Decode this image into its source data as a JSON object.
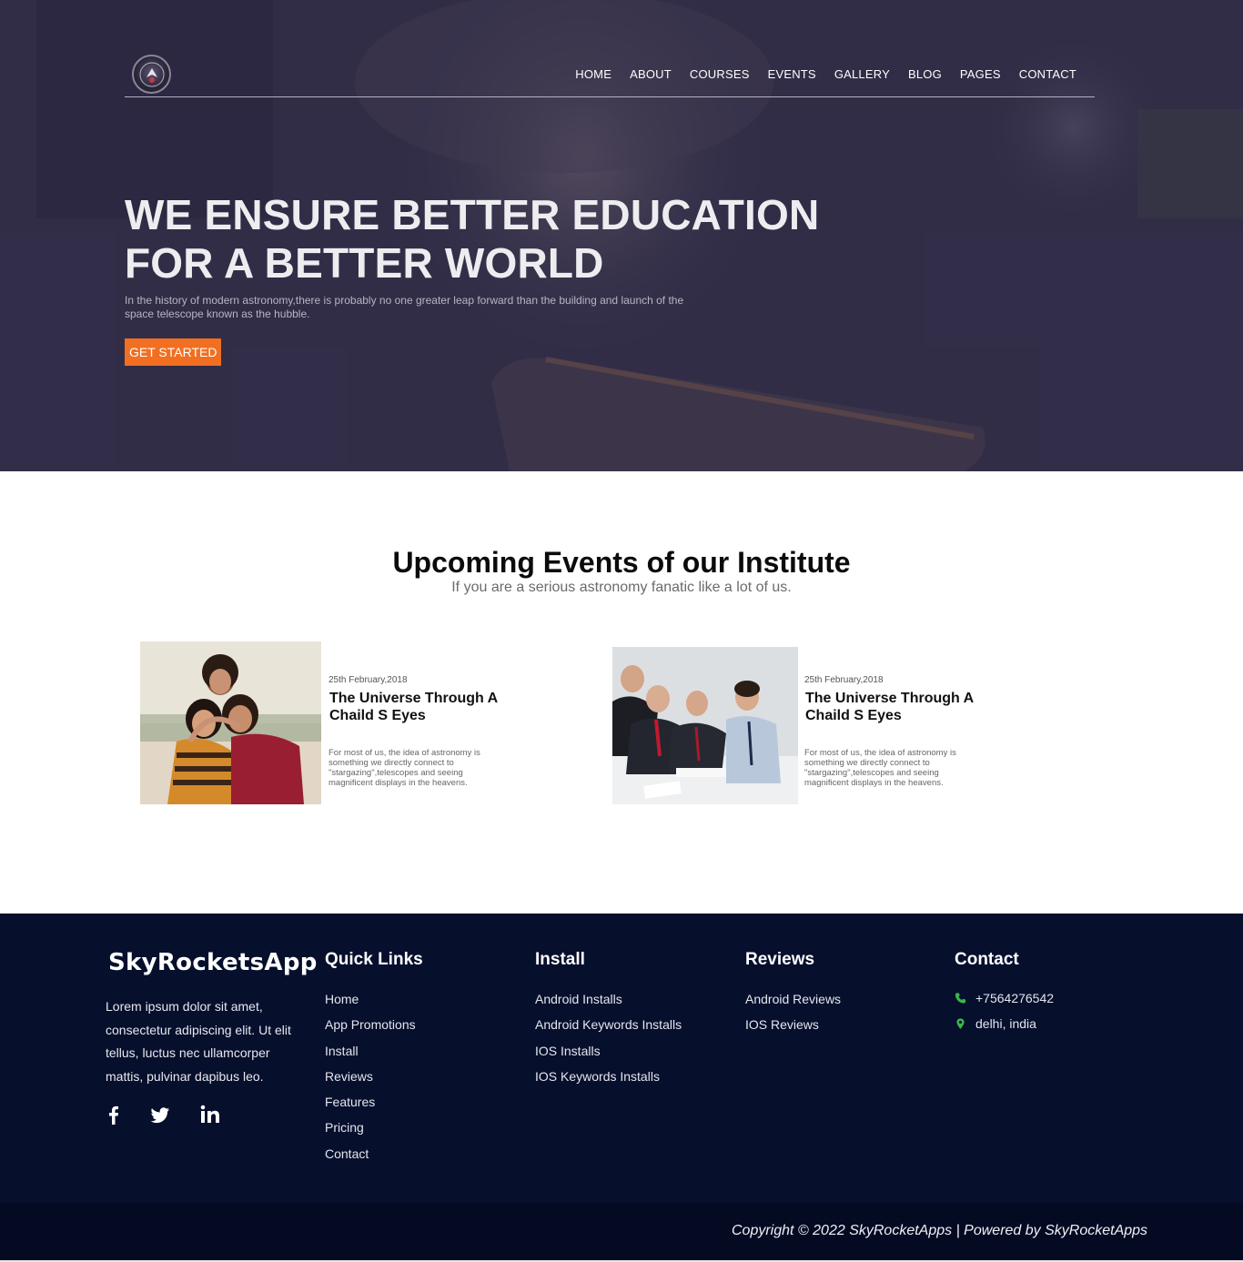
{
  "nav": {
    "items": [
      "HOME",
      "ABOUT",
      "COURSES",
      "EVENTS",
      "GALLERY",
      "BLOG",
      "PAGES",
      "CONTACT"
    ]
  },
  "hero": {
    "title_line1": "WE ENSURE BETTER EDUCATION",
    "title_line2": "FOR A BETTER WORLD",
    "subtitle": "In the history of modern astronomy,there is probably no one greater leap forward than the building and launch of the space telescope known as the hubble.",
    "cta": "GET STARTED"
  },
  "events": {
    "title": "Upcoming Events of our Institute",
    "subtitle": "If you are a serious astronomy fanatic like a lot of us.",
    "cards": [
      {
        "date": "25th February,2018",
        "title": "The Universe Through A Chaild S Eyes",
        "desc": "For most of us, the idea of astronomy is something we directly connect to \"stargazing\",telescopes and seeing magnificent displays in the heavens."
      },
      {
        "date": "25th February,2018",
        "title": "The Universe Through A Chaild S Eyes",
        "desc": "For most of us, the idea of astronomy is something we directly connect to \"stargazing\",telescopes and seeing magnificent displays in the heavens."
      }
    ]
  },
  "footer": {
    "brand": "SkyRocketsApp",
    "about": "Lorem ipsum dolor sit amet, consectetur adipiscing elit. Ut elit tellus, luctus nec ullamcorper mattis, pulvinar dapibus leo.",
    "social_icons": [
      "facebook-icon",
      "twitter-icon",
      "linkedin-icon"
    ],
    "quick_links": {
      "heading": "Quick Links",
      "items": [
        "Home",
        "App Promotions",
        "Install",
        "Reviews",
        "Features",
        "Pricing",
        "Contact"
      ]
    },
    "install": {
      "heading": "Install",
      "items": [
        "Android Installs",
        "Android Keywords Installs",
        "IOS Installs",
        "IOS Keywords Installs"
      ]
    },
    "reviews": {
      "heading": "Reviews",
      "items": [
        "Android Reviews",
        "IOS Reviews"
      ]
    },
    "contact": {
      "heading": "Contact",
      "phone": "+7564276542",
      "location": "delhi, india"
    },
    "copyright": "Copyright © 2022 SkyRocketApps | Powered by SkyRocketApps"
  },
  "colors": {
    "accent": "#f26f21",
    "footer_bg": "#060f2c",
    "hero_overlay": "#2c2840",
    "contact_icon": "#3ab54a"
  }
}
